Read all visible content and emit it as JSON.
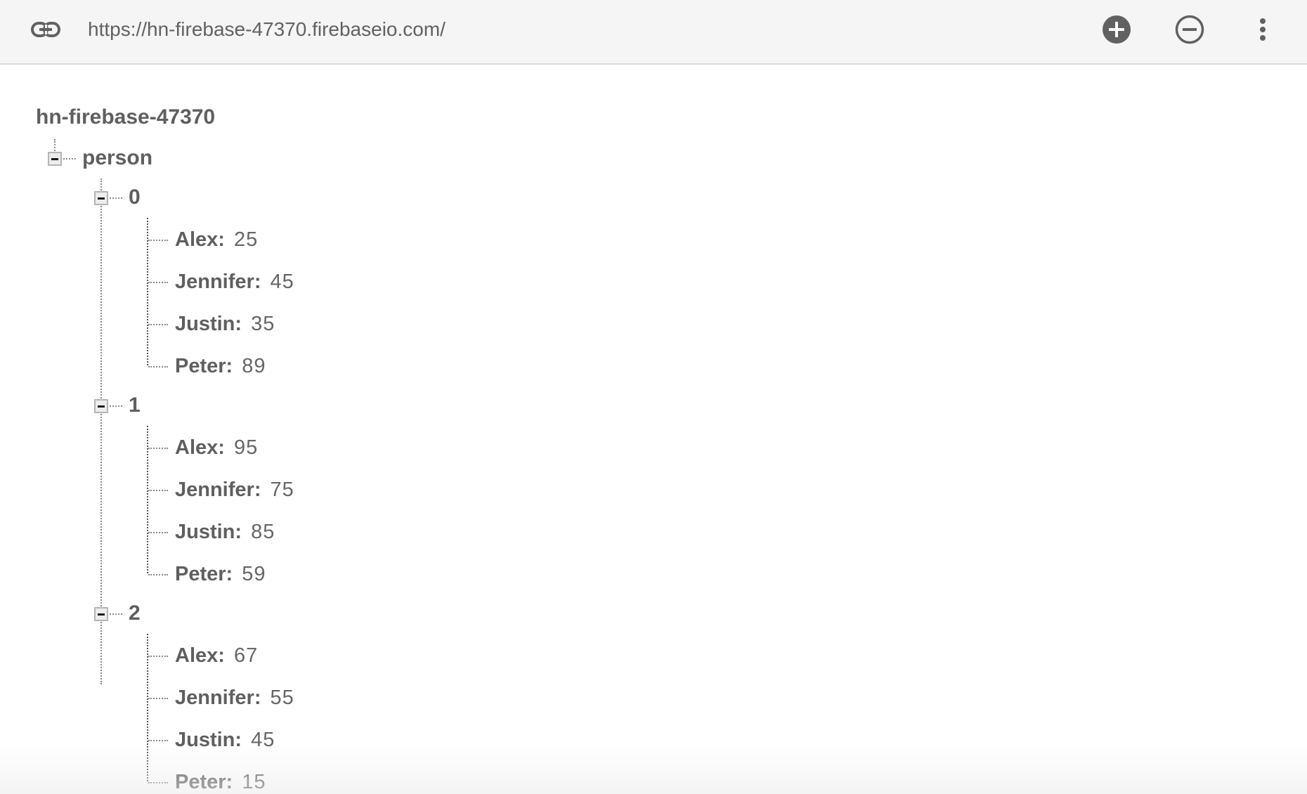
{
  "topbar": {
    "url": "https://hn-firebase-47370.firebaseio.com/",
    "link_icon": "link-icon",
    "add_icon": "add-circle-icon",
    "remove_icon": "remove-circle-outline-icon",
    "more_icon": "more-vert-icon"
  },
  "tree": {
    "root": "hn-firebase-47370",
    "child": {
      "label": "person",
      "entries": [
        {
          "label": "0",
          "fields": [
            {
              "key": "Alex",
              "value": "25"
            },
            {
              "key": "Jennifer",
              "value": "45"
            },
            {
              "key": "Justin",
              "value": "35"
            },
            {
              "key": "Peter",
              "value": "89"
            }
          ]
        },
        {
          "label": "1",
          "fields": [
            {
              "key": "Alex",
              "value": "95"
            },
            {
              "key": "Jennifer",
              "value": "75"
            },
            {
              "key": "Justin",
              "value": "85"
            },
            {
              "key": "Peter",
              "value": "59"
            }
          ]
        },
        {
          "label": "2",
          "fields": [
            {
              "key": "Alex",
              "value": "67"
            },
            {
              "key": "Jennifer",
              "value": "55"
            },
            {
              "key": "Justin",
              "value": "45"
            },
            {
              "key": "Peter",
              "value": "15"
            }
          ]
        }
      ]
    }
  },
  "colors": {
    "topbar_bg": "#f5f5f5",
    "icon": "#616161",
    "text": "#5f5f5f"
  }
}
